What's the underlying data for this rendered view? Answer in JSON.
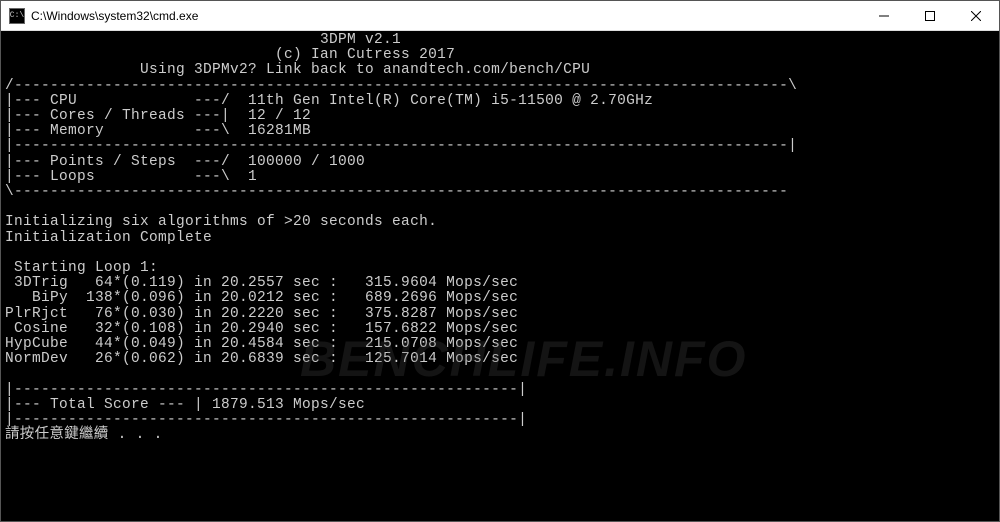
{
  "window": {
    "title": "C:\\Windows\\system32\\cmd.exe"
  },
  "header": {
    "app_title": "3DPM v2.1",
    "copyright": "(c) Ian Cutress 2017",
    "link_line": "Using 3DPMv2? Link back to anandtech.com/bench/CPU"
  },
  "sysinfo": {
    "cpu": "11th Gen Intel(R) Core(TM) i5-11500 @ 2.70GHz",
    "cores_threads": "12 / 12",
    "memory": "16281MB",
    "points_steps": "100000 / 1000",
    "loops": "1"
  },
  "init": {
    "line1": "Initializing six algorithms of >20 seconds each.",
    "line2": "Initialization Complete"
  },
  "loop": {
    "heading": " Starting Loop 1:",
    "rows": [
      {
        "name": " 3DTrig",
        "mult": "64",
        "per": "0.119",
        "sec": "20.2557",
        "mops": "315.9604"
      },
      {
        "name": "   BiPy",
        "mult": "138",
        "per": "0.096",
        "sec": "20.0212",
        "mops": "689.2696"
      },
      {
        "name": "PlrRjct",
        "mult": "76",
        "per": "0.030",
        "sec": "20.2220",
        "mops": "375.8287"
      },
      {
        "name": " Cosine",
        "mult": "32",
        "per": "0.108",
        "sec": "20.2940",
        "mops": "157.6822"
      },
      {
        "name": "HypCube",
        "mult": "44",
        "per": "0.049",
        "sec": "20.4584",
        "mops": "215.0708"
      },
      {
        "name": "NormDev",
        "mult": "26",
        "per": "0.062",
        "sec": "20.6839",
        "mops": "125.7014"
      }
    ]
  },
  "total": {
    "label": "Total Score",
    "value": "1879.513 Mops/sec"
  },
  "prompt": "請按任意鍵繼續 . . .",
  "watermark": "BENCHLIFE.INFO",
  "divider88": "/--------------------------------------------------------------------------------------\\",
  "divider88mid": "|--------------------------------------------------------------------------------------|",
  "divider88end": "\\--------------------------------------------------------------------------------------",
  "divider56": "|--------------------------------------------------------|",
  "cpu_label": "|--- CPU             ---/  ",
  "cores_label": "|--- Cores / Threads ---|  ",
  "memory_label": "|--- Memory          ---\\  ",
  "points_label": "|--- Points / Steps  ---/  ",
  "loops_label": "|--- Loops           ---\\  ",
  "total_prefix": "|--- Total Score --- | "
}
